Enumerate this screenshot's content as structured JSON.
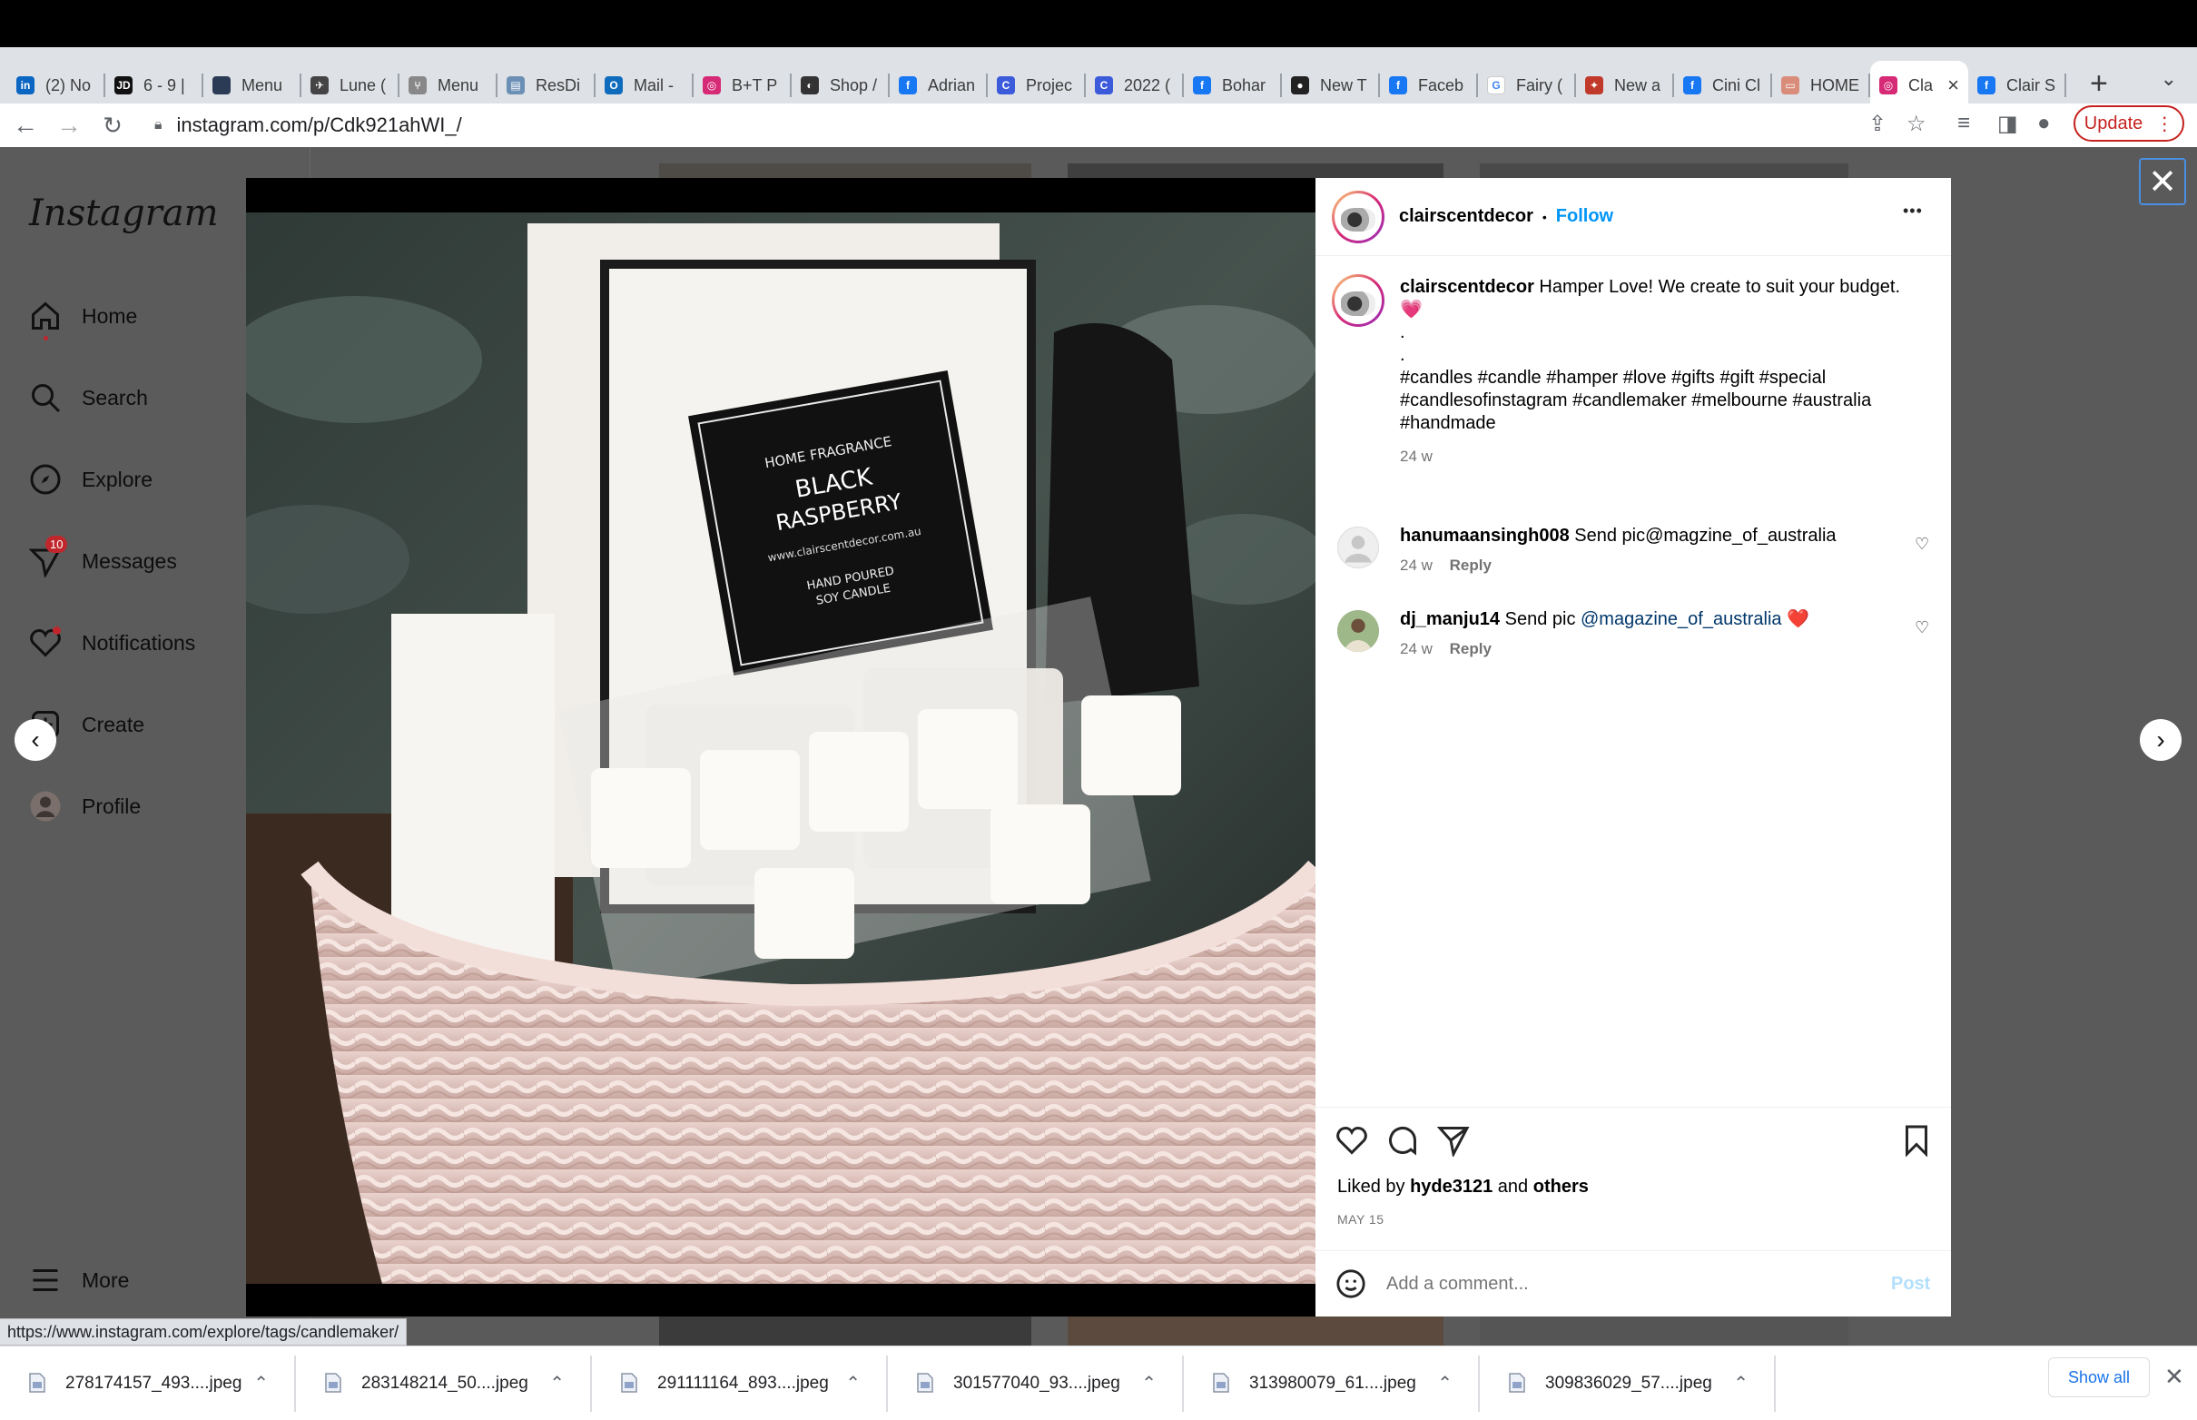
{
  "browser": {
    "tabs": [
      {
        "label": "(2) No",
        "icon": "linkedin-icon",
        "color": "#0a66c2",
        "glyph": "in"
      },
      {
        "label": "6 - 9 |",
        "icon": "jd-icon",
        "color": "#111111",
        "glyph": "JD"
      },
      {
        "label": "Menu",
        "icon": "menu-site-icon",
        "color": "#2b3a55",
        "glyph": ""
      },
      {
        "label": "Lune (",
        "icon": "rocket-icon",
        "color": "#444444",
        "glyph": "✈"
      },
      {
        "label": "Menu",
        "icon": "fork-icon",
        "color": "#888888",
        "glyph": "⑂"
      },
      {
        "label": "ResDi",
        "icon": "doc-icon",
        "color": "#6b8fb5",
        "glyph": "▤"
      },
      {
        "label": "Mail -",
        "icon": "outlook-icon",
        "color": "#0f6cbd",
        "glyph": "O"
      },
      {
        "label": "B+T P",
        "icon": "instagram-icon",
        "color": "#d62976",
        "glyph": "◎"
      },
      {
        "label": "Shop /",
        "icon": "shop-icon",
        "color": "#333333",
        "glyph": "◐"
      },
      {
        "label": "Adrian",
        "icon": "facebook-icon",
        "color": "#1877f2",
        "glyph": "f"
      },
      {
        "label": "Projec",
        "icon": "c-circle-icon",
        "color": "#3b5bdb",
        "glyph": "C"
      },
      {
        "label": "2022 (",
        "icon": "c-circle-icon",
        "color": "#3b5bdb",
        "glyph": "C"
      },
      {
        "label": "Bohar",
        "icon": "facebook-icon",
        "color": "#1877f2",
        "glyph": "f"
      },
      {
        "label": "New T",
        "icon": "github-icon",
        "color": "#222222",
        "glyph": "●"
      },
      {
        "label": "Faceb",
        "icon": "facebook-icon",
        "color": "#1877f2",
        "glyph": "f"
      },
      {
        "label": "Fairy (",
        "icon": "google-icon",
        "color": "#ffffff",
        "glyph": "G"
      },
      {
        "label": "New a",
        "icon": "shield-icon",
        "color": "#c0392b",
        "glyph": "✦"
      },
      {
        "label": "Cini Cl",
        "icon": "facebook-icon",
        "color": "#1877f2",
        "glyph": "f"
      },
      {
        "label": "HOME",
        "icon": "home-site-icon",
        "color": "#d98c7a",
        "glyph": "▭"
      },
      {
        "label": "Cla",
        "icon": "instagram-icon",
        "color": "#d62976",
        "glyph": "◎",
        "active": true
      },
      {
        "label": "Clair S",
        "icon": "facebook-icon",
        "color": "#1877f2",
        "glyph": "f"
      }
    ],
    "new_tab": "+",
    "tab_menu": "⌄",
    "url": "instagram.com/p/Cdk921ahWI_/",
    "update_label": "Update",
    "status_url": "https://www.instagram.com/explore/tags/candlemaker/"
  },
  "instagram": {
    "logo": "Instagram",
    "nav": [
      {
        "label": "Home",
        "icon": "home-icon"
      },
      {
        "label": "Search",
        "icon": "search-icon"
      },
      {
        "label": "Explore",
        "icon": "compass-icon"
      },
      {
        "label": "Messages",
        "icon": "messenger-icon",
        "badge": "10"
      },
      {
        "label": "Notifications",
        "icon": "heart-icon"
      },
      {
        "label": "Create",
        "icon": "plus-square-icon"
      },
      {
        "label": "Profile",
        "icon": "profile-avatar-icon"
      },
      {
        "label": "More",
        "icon": "hamburger-icon"
      }
    ]
  },
  "post": {
    "username": "clairscentdecor",
    "separator": "•",
    "follow_label": "Follow",
    "more_label": "•••",
    "caption": {
      "username": "clairscentdecor",
      "text": "Hamper Love! We create to suit your budget.",
      "emoji": "💗",
      "dot1": ".",
      "dot2": ".",
      "tags_line1": "#candles #candle #hamper #love #gifts #gift #special",
      "tags_line2": "#candlesofinstagram #candlemaker #melbourne #australia",
      "tags_line3": "#handmade",
      "time": "24 w"
    },
    "comments": [
      {
        "username": "hanumaansingh008",
        "text": "Send pic@magzine_of_australia",
        "mention": "",
        "emoji": "",
        "time": "24 w",
        "reply": "Reply"
      },
      {
        "username": "dj_manju14",
        "text": "Send pic ",
        "mention": "@magazine_of_australia",
        "emoji": "❤️",
        "time": "24 w",
        "reply": "Reply"
      }
    ],
    "liked_by_prefix": "Liked by",
    "liked_by_user": "hyde3121",
    "liked_by_and": "and",
    "liked_by_others": "others",
    "date": "MAY 15",
    "comment_placeholder": "Add a comment...",
    "post_label": "Post",
    "image_label": {
      "line1": "HOME FRAGRANCE",
      "line2": "BLACK",
      "line3": "RASPBERRY",
      "line4": "www.clairscentdecor.com.au",
      "line5": "HAND POURED",
      "line6": "SOY CANDLE"
    }
  },
  "downloads": {
    "items": [
      "278174157_493....jpeg",
      "283148214_50....jpeg",
      "291111164_893....jpeg",
      "301577040_93....jpeg",
      "313980079_61....jpeg",
      "309836029_57....jpeg"
    ],
    "show_all": "Show all",
    "close": "✕"
  },
  "colors": {
    "follow_blue": "#0095f6",
    "hashtag_blue": "#00376b",
    "update_red": "#c5221f",
    "overlay_gray": "#5a5a5a"
  }
}
